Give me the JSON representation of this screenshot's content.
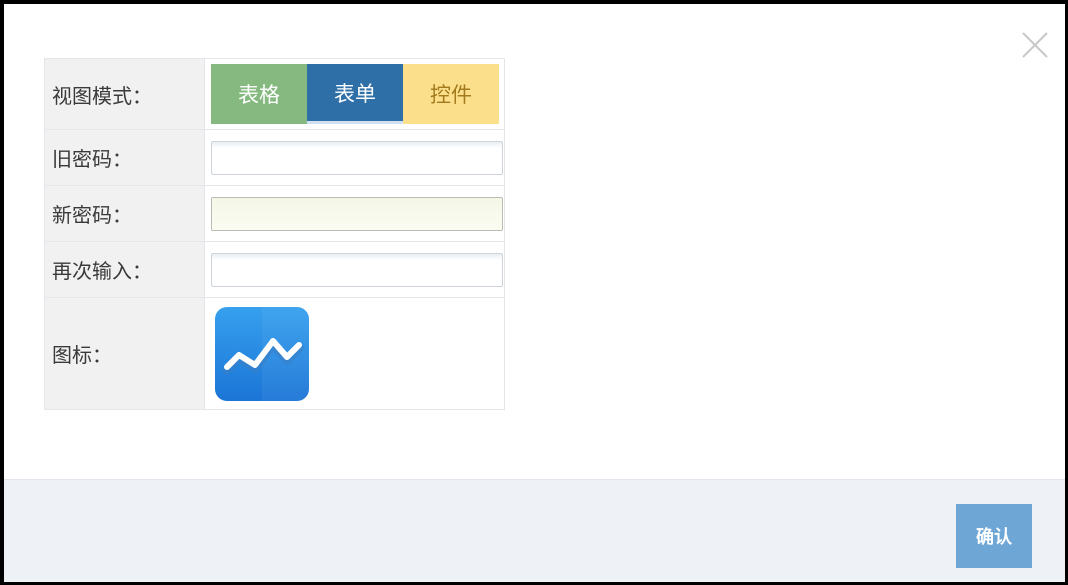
{
  "form": {
    "view_mode_label": "视图模式：",
    "view_modes": [
      {
        "label": "表格",
        "color": "#86b97f"
      },
      {
        "label": "表单",
        "color": "#2f6fa8"
      },
      {
        "label": "控件",
        "color": "#fcdf8a"
      }
    ],
    "selected_mode": "表单",
    "old_password_label": "旧密码：",
    "old_password_value": "",
    "new_password_label": "新密码：",
    "new_password_value": "",
    "confirm_password_label": "再次输入：",
    "confirm_password_value": "",
    "icon_label": "图标：",
    "icon_name": "line-chart-icon"
  },
  "footer": {
    "confirm_label": "确认",
    "confirm_color": "#6ea6d6"
  },
  "close_icon": "close-icon"
}
